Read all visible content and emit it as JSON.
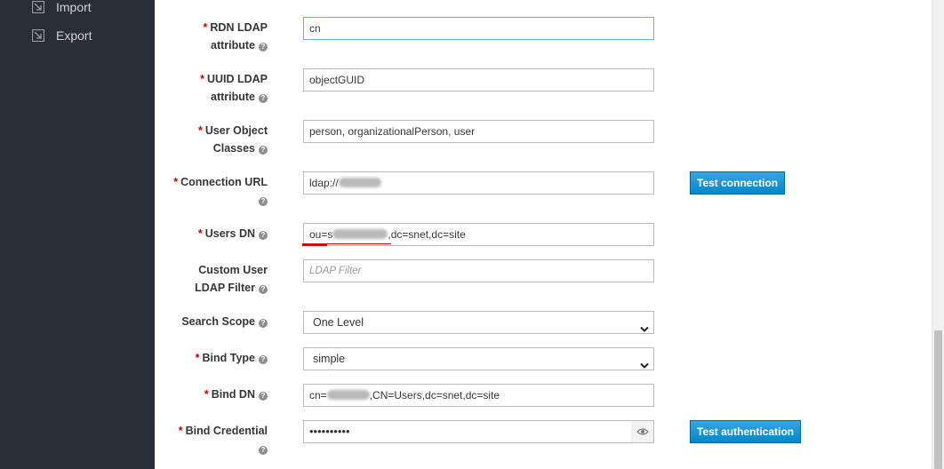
{
  "sidebar": {
    "items": [
      {
        "label": "Import",
        "icon": "import-icon"
      },
      {
        "label": "Export",
        "icon": "export-icon"
      }
    ]
  },
  "form": {
    "rdn": {
      "label_l1": "RDN LDAP",
      "label_l2": "attribute",
      "value": "cn"
    },
    "uuid": {
      "label_l1": "UUID LDAP",
      "label_l2": "attribute",
      "value": "objectGUID"
    },
    "user_object_classes": {
      "label_l1": "User Object",
      "label_l2": "Classes",
      "value": "person, organizationalPerson, user"
    },
    "connection_url": {
      "label": "Connection URL",
      "value_prefix": "ldap://",
      "test_button": "Test connection"
    },
    "users_dn": {
      "label": "Users DN",
      "value_prefix": "ou=s",
      "value_suffix": ",dc=snet,dc=site"
    },
    "custom_filter": {
      "label_l1": "Custom User",
      "label_l2": "LDAP Filter",
      "placeholder": "LDAP Filter"
    },
    "search_scope": {
      "label": "Search Scope",
      "value": "One Level"
    },
    "bind_type": {
      "label": "Bind Type",
      "value": "simple"
    },
    "bind_dn": {
      "label": "Bind DN",
      "value_prefix": "cn=",
      "value_suffix": ",CN=Users,dc=snet,dc=site"
    },
    "bind_credential": {
      "label": "Bind Credential",
      "value": "••••••••••",
      "test_button": "Test authentication"
    },
    "required_mark": "*",
    "help_glyph": "?"
  },
  "colors": {
    "sidebar_bg": "#292e34",
    "button_blue": "#0088ce",
    "required_red": "#cc0000"
  }
}
